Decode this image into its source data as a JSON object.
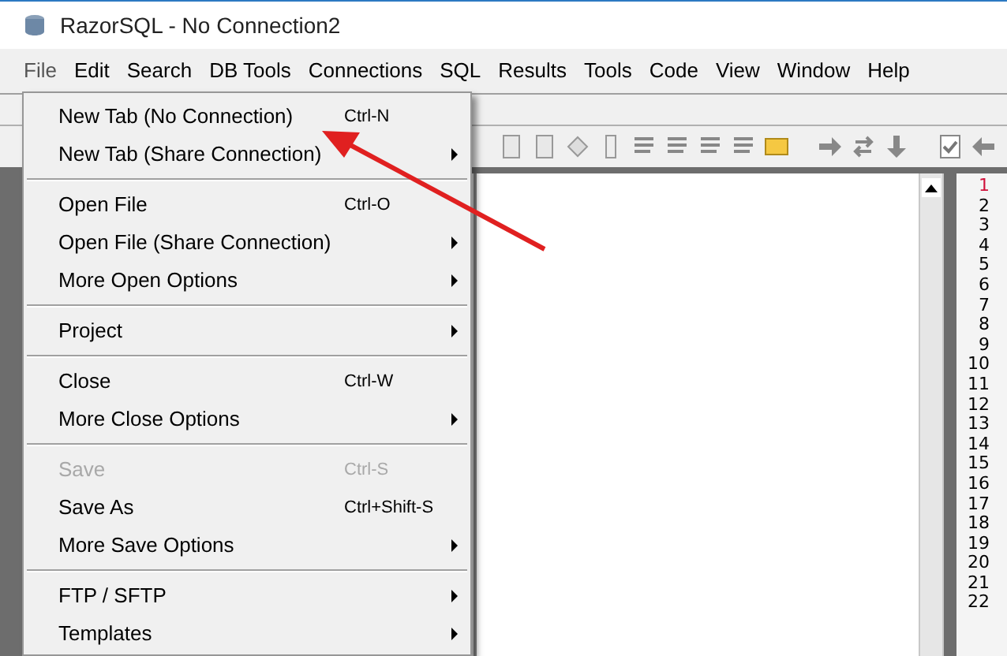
{
  "window": {
    "title": "RazorSQL - No Connection2"
  },
  "menu_bar": [
    {
      "label": "File",
      "selected": true
    },
    {
      "label": "Edit",
      "selected": false
    },
    {
      "label": "Search",
      "selected": false
    },
    {
      "label": "DB Tools",
      "selected": false
    },
    {
      "label": "Connections",
      "selected": false
    },
    {
      "label": "SQL",
      "selected": false
    },
    {
      "label": "Results",
      "selected": false
    },
    {
      "label": "Tools",
      "selected": false
    },
    {
      "label": "Code",
      "selected": false
    },
    {
      "label": "View",
      "selected": false
    },
    {
      "label": "Window",
      "selected": false
    },
    {
      "label": "Help",
      "selected": false
    }
  ],
  "file_menu": [
    {
      "kind": "item",
      "label": "New Tab (No Connection)",
      "shortcut": "Ctrl-N",
      "submenu": false,
      "disabled": false
    },
    {
      "kind": "item",
      "label": "New Tab (Share Connection)",
      "submenu": true,
      "disabled": false
    },
    {
      "kind": "separator"
    },
    {
      "kind": "item",
      "label": "Open File",
      "shortcut": "Ctrl-O",
      "submenu": false,
      "disabled": false
    },
    {
      "kind": "item",
      "label": "Open File (Share Connection)",
      "submenu": true,
      "disabled": false
    },
    {
      "kind": "item",
      "label": "More Open Options",
      "submenu": true,
      "disabled": false
    },
    {
      "kind": "separator"
    },
    {
      "kind": "item",
      "label": "Project",
      "submenu": true,
      "disabled": false
    },
    {
      "kind": "separator"
    },
    {
      "kind": "item",
      "label": "Close",
      "shortcut": "Ctrl-W",
      "submenu": false,
      "disabled": false
    },
    {
      "kind": "item",
      "label": "More Close Options",
      "submenu": true,
      "disabled": false
    },
    {
      "kind": "separator"
    },
    {
      "kind": "item",
      "label": "Save",
      "shortcut": "Ctrl-S",
      "submenu": false,
      "disabled": true
    },
    {
      "kind": "item",
      "label": "Save As",
      "shortcut": "Ctrl+Shift-S",
      "submenu": false,
      "disabled": false
    },
    {
      "kind": "item",
      "label": "More Save Options",
      "submenu": true,
      "disabled": false
    },
    {
      "kind": "separator"
    },
    {
      "kind": "item",
      "label": "FTP / SFTP",
      "submenu": true,
      "disabled": false
    },
    {
      "kind": "item",
      "label": "Templates",
      "submenu": true,
      "disabled": false
    }
  ],
  "line_numbers": [
    {
      "label": "1",
      "current": true
    },
    {
      "label": "2",
      "current": false
    },
    {
      "label": "3",
      "current": false
    },
    {
      "label": "4",
      "current": false
    },
    {
      "label": "5",
      "current": false
    },
    {
      "label": "6",
      "current": false
    },
    {
      "label": "7",
      "current": false
    },
    {
      "label": "8",
      "current": false
    },
    {
      "label": "9",
      "current": false
    },
    {
      "label": "10",
      "current": false
    },
    {
      "label": "11",
      "current": false
    },
    {
      "label": "12",
      "current": false
    },
    {
      "label": "13",
      "current": false
    },
    {
      "label": "14",
      "current": false
    },
    {
      "label": "15",
      "current": false
    },
    {
      "label": "16",
      "current": false
    },
    {
      "label": "17",
      "current": false
    },
    {
      "label": "18",
      "current": false
    },
    {
      "label": "19",
      "current": false
    },
    {
      "label": "20",
      "current": false
    },
    {
      "label": "21",
      "current": false
    },
    {
      "label": "22",
      "current": false
    }
  ],
  "annotations": [
    {
      "kind": "arrow"
    }
  ]
}
